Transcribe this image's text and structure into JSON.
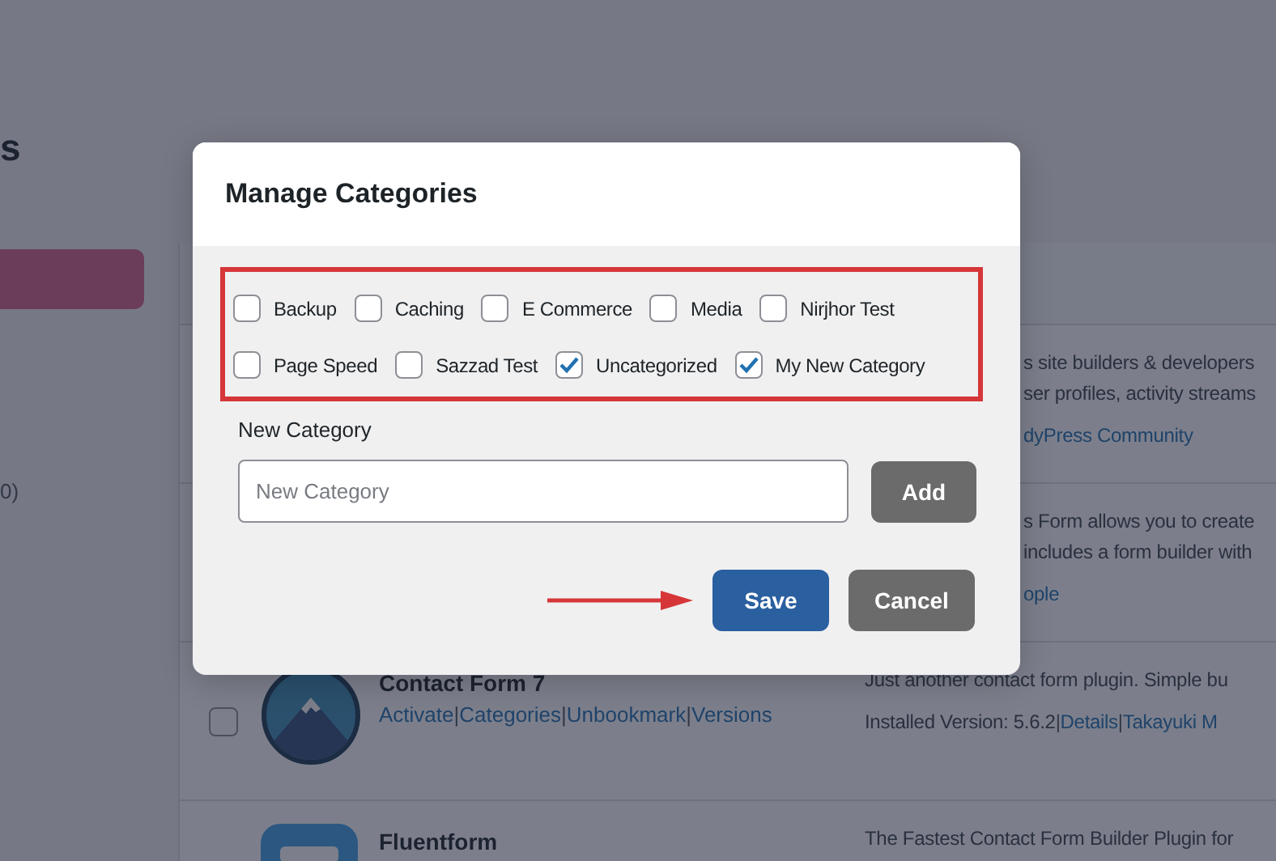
{
  "background": {
    "heading": "s",
    "sidebar_count": "0)",
    "link_separator": "|",
    "plugins": [
      {
        "description": [
          "s site builders & developers",
          "ser profiles, activity streams"
        ],
        "meta_links": [
          "dyPress Community"
        ]
      },
      {
        "description": [
          "s Form allows you to create",
          "includes a form builder with"
        ],
        "meta_links": [
          "ople"
        ]
      },
      {
        "name": "Contact Form 7",
        "checked": false,
        "actions": [
          "Activate",
          "Categories",
          "Unbookmark",
          "Versions"
        ],
        "description": [
          "Just another contact form plugin. Simple bu"
        ],
        "meta_text": "Installed Version: 5.6.2",
        "meta_links": [
          "Details",
          "Takayuki M"
        ]
      },
      {
        "name": "Fluentform",
        "description": [
          "The Fastest Contact Form Builder Plugin for"
        ]
      }
    ]
  },
  "modal": {
    "title": "Manage Categories",
    "categories": [
      {
        "label": "Backup",
        "checked": false
      },
      {
        "label": "Caching",
        "checked": false
      },
      {
        "label": "E Commerce",
        "checked": false
      },
      {
        "label": "Media",
        "checked": false
      },
      {
        "label": "Nirjhor Test",
        "checked": false
      },
      {
        "label": "Page Speed",
        "checked": false
      },
      {
        "label": "Sazzad Test",
        "checked": false
      },
      {
        "label": "Uncategorized",
        "checked": true
      },
      {
        "label": "My New Category",
        "checked": true
      }
    ],
    "new_category_label": "New Category",
    "new_category_placeholder": "New Category",
    "buttons": {
      "add": "Add",
      "save": "Save",
      "cancel": "Cancel"
    }
  }
}
